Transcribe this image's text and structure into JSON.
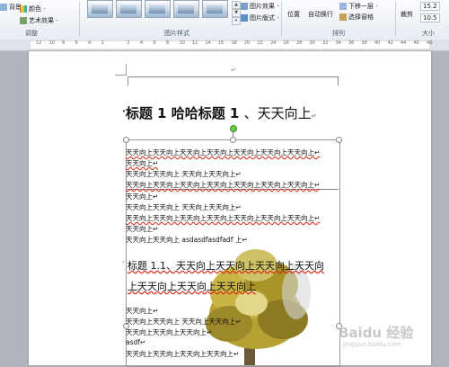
{
  "ribbon": {
    "left_items": [
      "背景",
      "颜色 ·",
      "艺术效果 ·"
    ],
    "picture_style_group": "图片样式",
    "adjust_group": "调整",
    "picture_effect": "图片效果 ·",
    "picture_layout": "图片版式 ·",
    "position": "位置",
    "auto_wrap": "自动换行",
    "arrange_group": "排列",
    "next_layer": "下移一层 ·",
    "selection_pane": "选择窗格",
    "crop": "裁剪",
    "size_group": "大小",
    "height_value": "15.2",
    "width_value": "10.5"
  },
  "ruler": {
    "numbers": [
      "12",
      "10",
      "8",
      "6",
      "4",
      "2",
      "",
      "2",
      "4",
      "6",
      "8",
      "10",
      "12",
      "14",
      "16",
      "18",
      "20",
      "22",
      "24",
      "26",
      "28",
      "30",
      "32",
      "34",
      "36",
      "38",
      "40",
      "42",
      "44",
      "46",
      "48"
    ]
  },
  "document": {
    "header_mark": "↵",
    "heading1": {
      "bold": "标题 1  哈哈标题 1",
      "rest": "、天天向上",
      "mark": "↵"
    },
    "lines": [
      "天天向上天天向上天天向上天天向上天天向上天天向上天天向上↵",
      "天天向上↵",
      "天天向上天天向上      天天向上天天向上↵",
      "天天向上天天向上天天向上天天向上天天向上天天向上天天向上↵",
      "天天向上↵",
      "天天向上天天向上      天天向上天天向上↵",
      "天天向上天天向上天天向上天天向上天天向上天天向上天天向上↵",
      "天天向上↵",
      "天天向上天天向上      asdasdfasdfadf 上↵"
    ],
    "heading2_line1": "标题 1.1、天天向上天天向上天天向上天天向",
    "heading2_line2": "上天天向上天天向上天天向上",
    "lines_after": [
      "天天向上↵",
      "天天向上天天向上      天天向上天天向上↵",
      "天天向上天天向上天天向上↵",
      "asdf↵",
      "天天向上天天向上天天向上天天向上↵"
    ]
  },
  "watermark": {
    "brand": "Baidu 经验",
    "url": "jingyan.baidu.com"
  }
}
